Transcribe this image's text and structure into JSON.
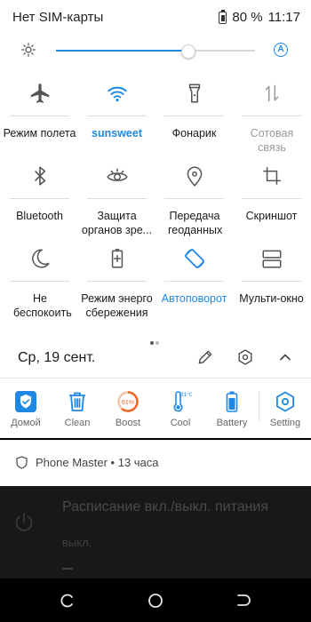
{
  "status": {
    "carrier": "Нет SIM-карты",
    "battery": "80 %",
    "time": "11:17"
  },
  "brightness": {
    "level_percent": 66,
    "auto_label": "A"
  },
  "tiles": [
    {
      "label": "Режим полета",
      "icon": "airplane-icon",
      "state": "off"
    },
    {
      "label": "sunsweet",
      "icon": "wifi-icon",
      "state": "active"
    },
    {
      "label": "Фонарик",
      "icon": "flashlight-icon",
      "state": "off"
    },
    {
      "label": "Сотовая связь",
      "icon": "mobile-data-icon",
      "state": "disabled"
    },
    {
      "label": "Bluetooth",
      "icon": "bluetooth-icon",
      "state": "off"
    },
    {
      "label": "Защита органов зре...",
      "icon": "eye-icon",
      "state": "off"
    },
    {
      "label": "Передача геоданных",
      "icon": "location-icon",
      "state": "off"
    },
    {
      "label": "Скриншот",
      "icon": "screenshot-icon",
      "state": "off"
    },
    {
      "label": "Не беспокоить",
      "icon": "moon-icon",
      "state": "off"
    },
    {
      "label": "Режим энерго сбережения",
      "icon": "battery-saver-icon",
      "state": "off"
    },
    {
      "label": "Автоповорот",
      "icon": "autorotate-icon",
      "state": "active"
    },
    {
      "label": "Мульти-окно",
      "icon": "multiwindow-icon",
      "state": "off"
    }
  ],
  "page_indicator": {
    "pages": 2,
    "current": 1
  },
  "date_row": {
    "date": "Ср, 19 сент.",
    "icons": [
      "edit-icon",
      "settings-icon",
      "collapse-icon"
    ]
  },
  "toolbar": {
    "items": [
      {
        "label": "Домой",
        "icon": "home-shield-icon"
      },
      {
        "label": "Clean",
        "icon": "trash-icon"
      },
      {
        "label": "Boost",
        "icon": "boost-icon",
        "value": "61%"
      },
      {
        "label": "Cool",
        "icon": "thermometer-icon",
        "value": "31°C"
      },
      {
        "label": "Battery",
        "icon": "battery-icon"
      },
      {
        "label": "Setting",
        "icon": "setting-hex-icon"
      }
    ]
  },
  "notification": {
    "text": "Phone Master • 13 часа",
    "icon": "shield-icon"
  },
  "background_item": {
    "title": "Расписание вкл./выкл. питания",
    "subtitle": "выкл.",
    "icon": "power-icon"
  },
  "navbar": {
    "icons": [
      "back-icon",
      "home-icon",
      "recents-icon"
    ]
  },
  "colors": {
    "accent": "#1e88e5",
    "boost": "#f26522"
  }
}
